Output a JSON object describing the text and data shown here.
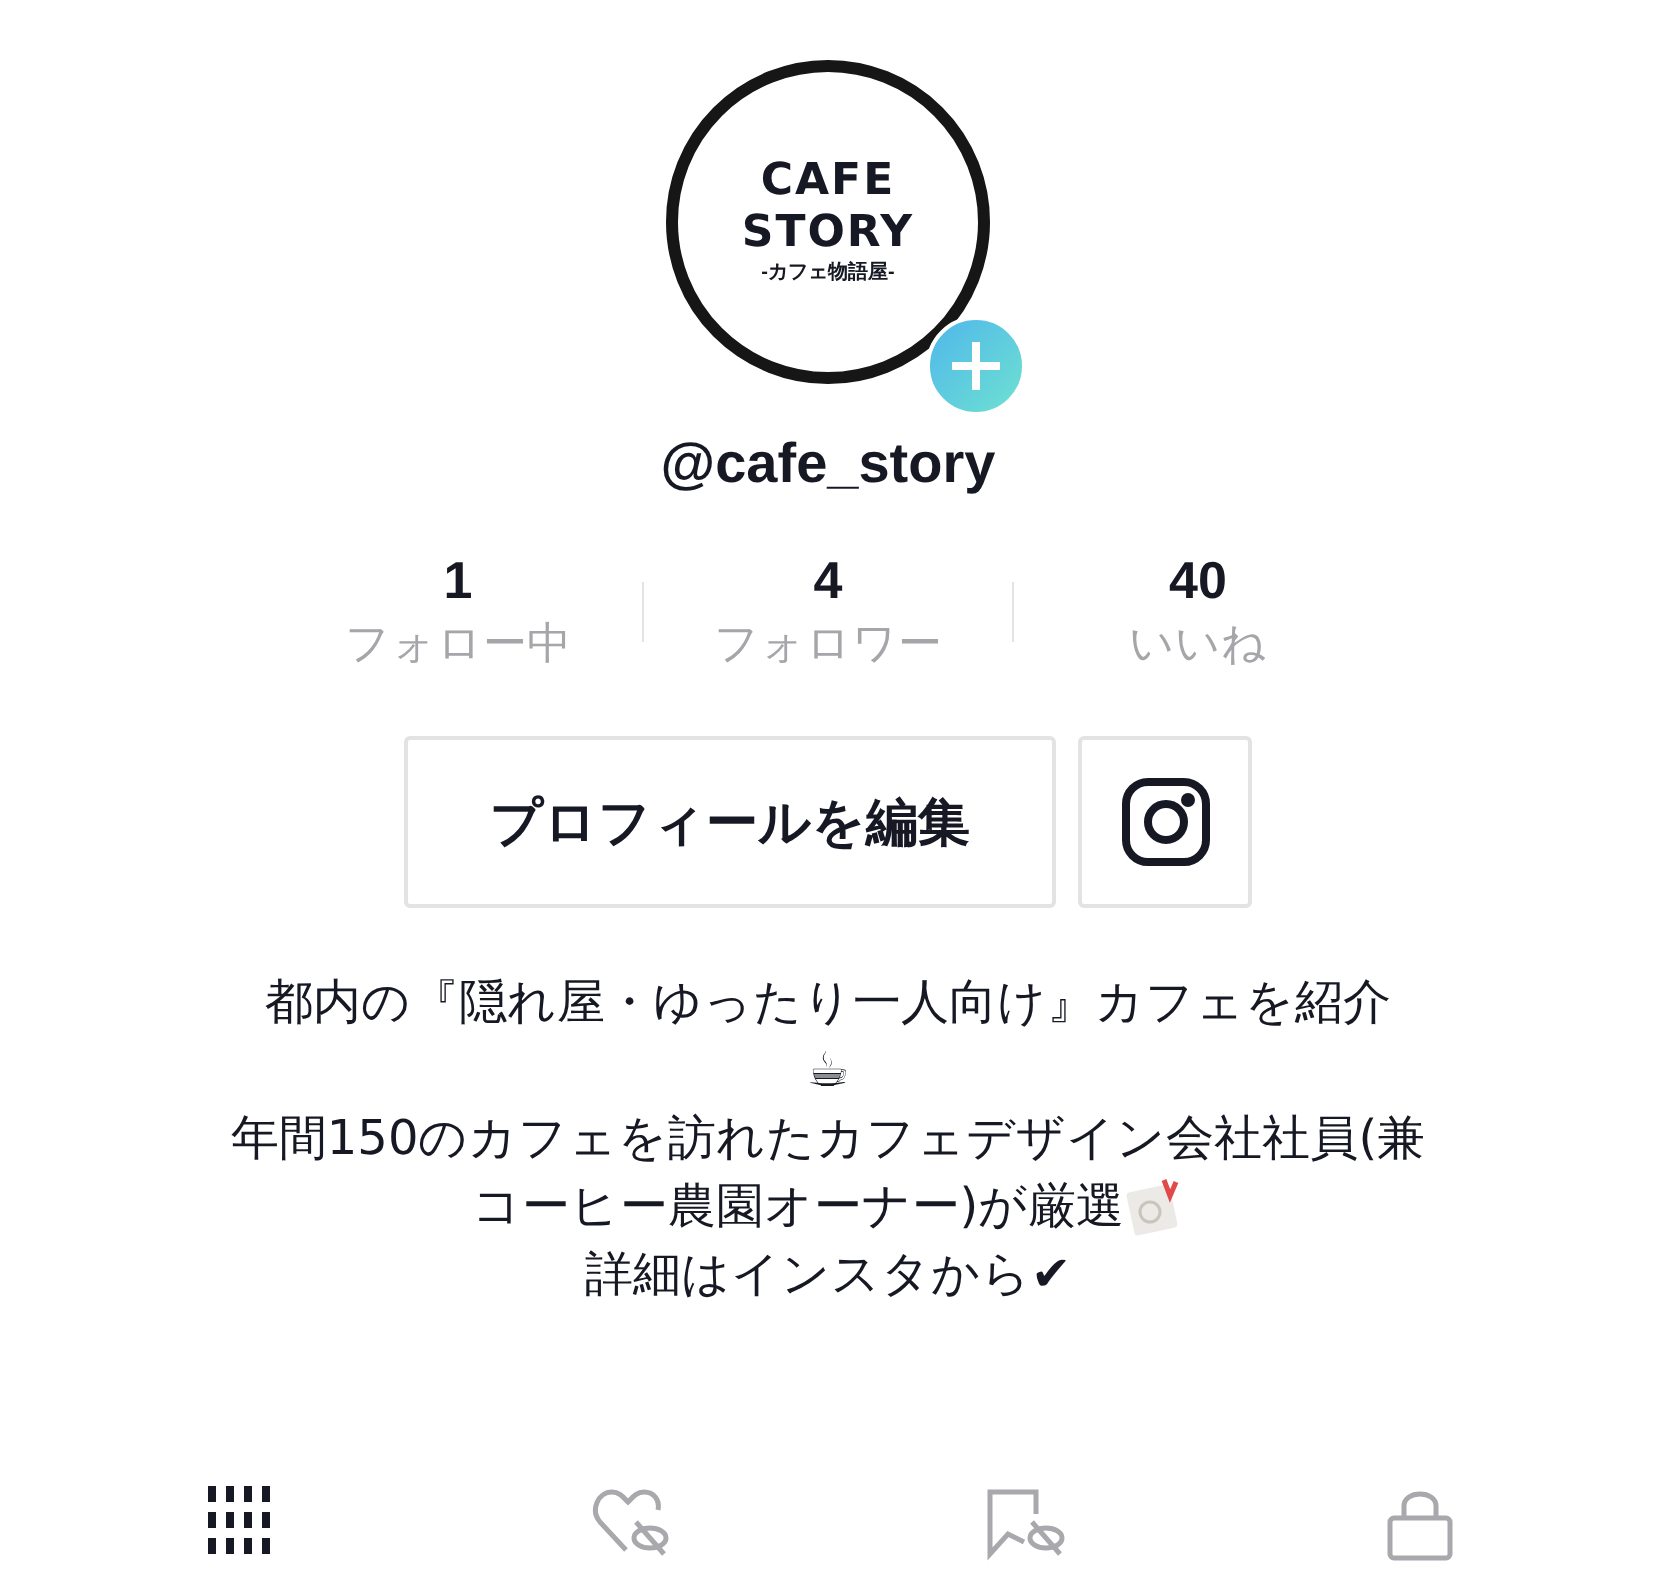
{
  "avatar": {
    "logo_lines": [
      "CAFE",
      "STORY"
    ],
    "logo_subtitle": "-カフェ物語屋-"
  },
  "username": "@cafe_story",
  "stats": [
    {
      "value": "1",
      "label": "フォロー中"
    },
    {
      "value": "4",
      "label": "フォロワー"
    },
    {
      "value": "40",
      "label": "いいね"
    }
  ],
  "edit_button": "プロフィールを編集",
  "bio": [
    {
      "text": "都内の『隠れ屋・ゆったり一人向け』カフェを紹介"
    },
    {
      "text": "☕"
    },
    {
      "text": "年間150のカフェを訪れたカフェデザイン会社社員(兼"
    },
    {
      "text": "コーヒー農園オーナー)が厳選",
      "kind": "tag"
    },
    {
      "text": "詳細はインスタから✔"
    }
  ],
  "tabs": [
    {
      "kind": "grid",
      "selected": true
    },
    {
      "kind": "liked",
      "selected": false
    },
    {
      "kind": "saved",
      "selected": false
    },
    {
      "kind": "private",
      "selected": false
    }
  ]
}
